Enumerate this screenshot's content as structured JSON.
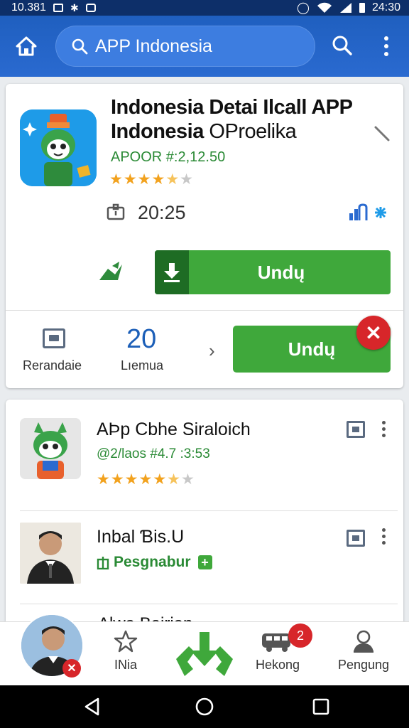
{
  "status_bar": {
    "time_left": "10.381",
    "time_right": "24:30"
  },
  "search": {
    "text": "APP Indonesia"
  },
  "featured": {
    "title_line1": "Indonesia Detai Ilcall APP",
    "title_line2_bold": "Indonesia",
    "title_line2_rest": " OProelika",
    "subtitle": "APOOR #:2,12.50",
    "rating_stars": 4.5,
    "time": "20:25",
    "download_label": "Undų",
    "recommend_label": "Rerandaie",
    "count_value": "20",
    "count_label": "Lıemua",
    "download_label_2": "Undų"
  },
  "list_items": [
    {
      "title": "AÞp Cbhe Siraloich",
      "subtitle": "@2/laos #4.7 :3:53",
      "rating_stars": 5
    },
    {
      "title": "Inbal Ɓis.U",
      "subtitle": "Pesgnabur"
    },
    {
      "title": "Alwa Bairian"
    }
  ],
  "bottom_nav": {
    "item1": "INia",
    "item3": "Hekong",
    "item3_badge": "2",
    "item4": "Pengung"
  },
  "colors": {
    "primary": "#2a6ad0",
    "green": "#3fa83b",
    "red": "#d7262a"
  }
}
